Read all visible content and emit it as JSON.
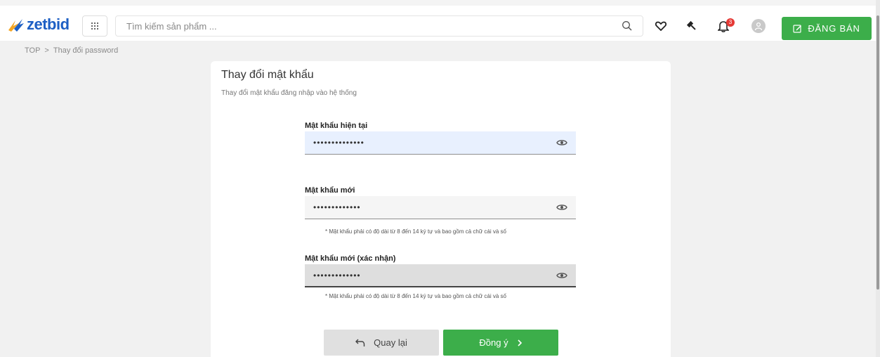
{
  "header": {
    "logo_text": "zetbid",
    "search_placeholder": "Tìm kiếm sản phẩm ...",
    "notification_count": "3",
    "sell_button_label": "ĐĂNG BÁN"
  },
  "breadcrumb": {
    "home": "TOP",
    "separator": ">",
    "current": "Thay đổi password"
  },
  "card": {
    "title": "Thay đổi mật khẩu",
    "subtitle": "Thay đổi mật khẩu đăng nhập vào hệ thống"
  },
  "fields": {
    "current_password": {
      "label": "Mật khẩu hiện tại",
      "value": "••••••••••••••"
    },
    "new_password": {
      "label": "Mật khẩu mới",
      "value": "•••••••••••••",
      "hint": "* Mật khẩu phải có độ dài từ 8 đến 14 ký tự và bao gồm cả chữ cái và số"
    },
    "confirm_password": {
      "label": "Mật khẩu mới (xác nhận)",
      "value": "•••••••••••••",
      "hint": "* Mật khẩu phải có độ dài từ 8 đến 14 ký tự và bao gồm cả chữ cái và số"
    }
  },
  "buttons": {
    "back": "Quay lại",
    "confirm": "Đồng ý"
  },
  "colors": {
    "brand_blue": "#1d5fc4",
    "brand_orange": "#f5a623",
    "accent_green": "#3cae4a",
    "focused_field_bg": "#e8f0fe",
    "field_bg": "#f5f5f5",
    "filled_field_bg": "#dedede"
  },
  "icons": [
    "grid-menu-icon",
    "search-icon",
    "heart-icon",
    "gavel-icon",
    "bell-icon",
    "user-avatar-icon",
    "edit-icon",
    "eye-icon",
    "undo-icon",
    "chevron-right-icon"
  ]
}
